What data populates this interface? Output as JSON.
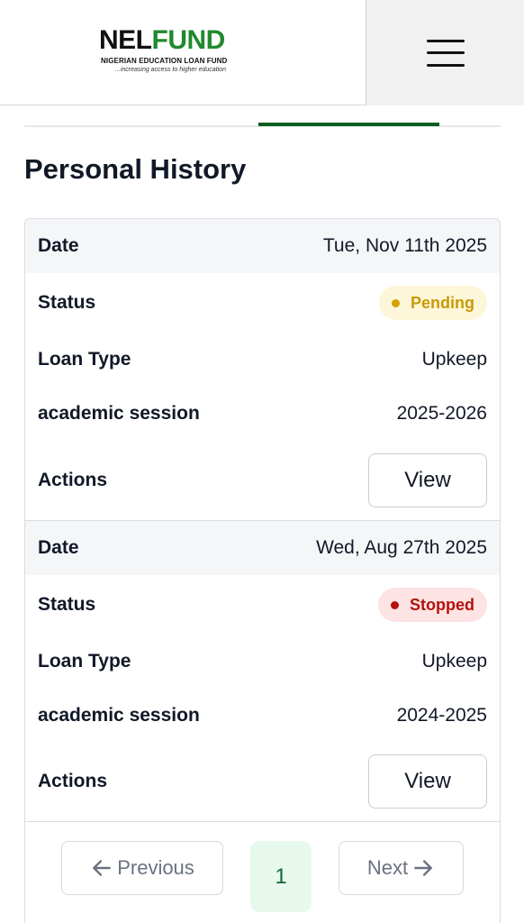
{
  "header": {
    "logo_nel": "NEL",
    "logo_fund": "FUND",
    "logo_subtitle": "NIGERIAN EDUCATION LOAN FUND",
    "logo_tagline": "...increasing access to higher education",
    "menu_icon": "hamburger-icon"
  },
  "page": {
    "title": "Personal History"
  },
  "labels": {
    "date": "Date",
    "status": "Status",
    "loan_type": "Loan Type",
    "academic_session": "academic session",
    "actions": "Actions"
  },
  "records": [
    {
      "date": "Tue, Nov 11th 2025",
      "status": "Pending",
      "loan_type": "Upkeep",
      "academic_session": "2025-2026",
      "action_label": "View"
    },
    {
      "date": "Wed, Aug 27th 2025",
      "status": "Stopped",
      "loan_type": "Upkeep",
      "academic_session": "2024-2025",
      "action_label": "View"
    }
  ],
  "pagination": {
    "previous_label": "Previous",
    "current_page": "1",
    "next_label": "Next"
  },
  "colors": {
    "brand_green": "#1f8a2e",
    "tab_active": "#0b5e1f",
    "pending": "#c99a06",
    "stopped": "#b3120d"
  }
}
